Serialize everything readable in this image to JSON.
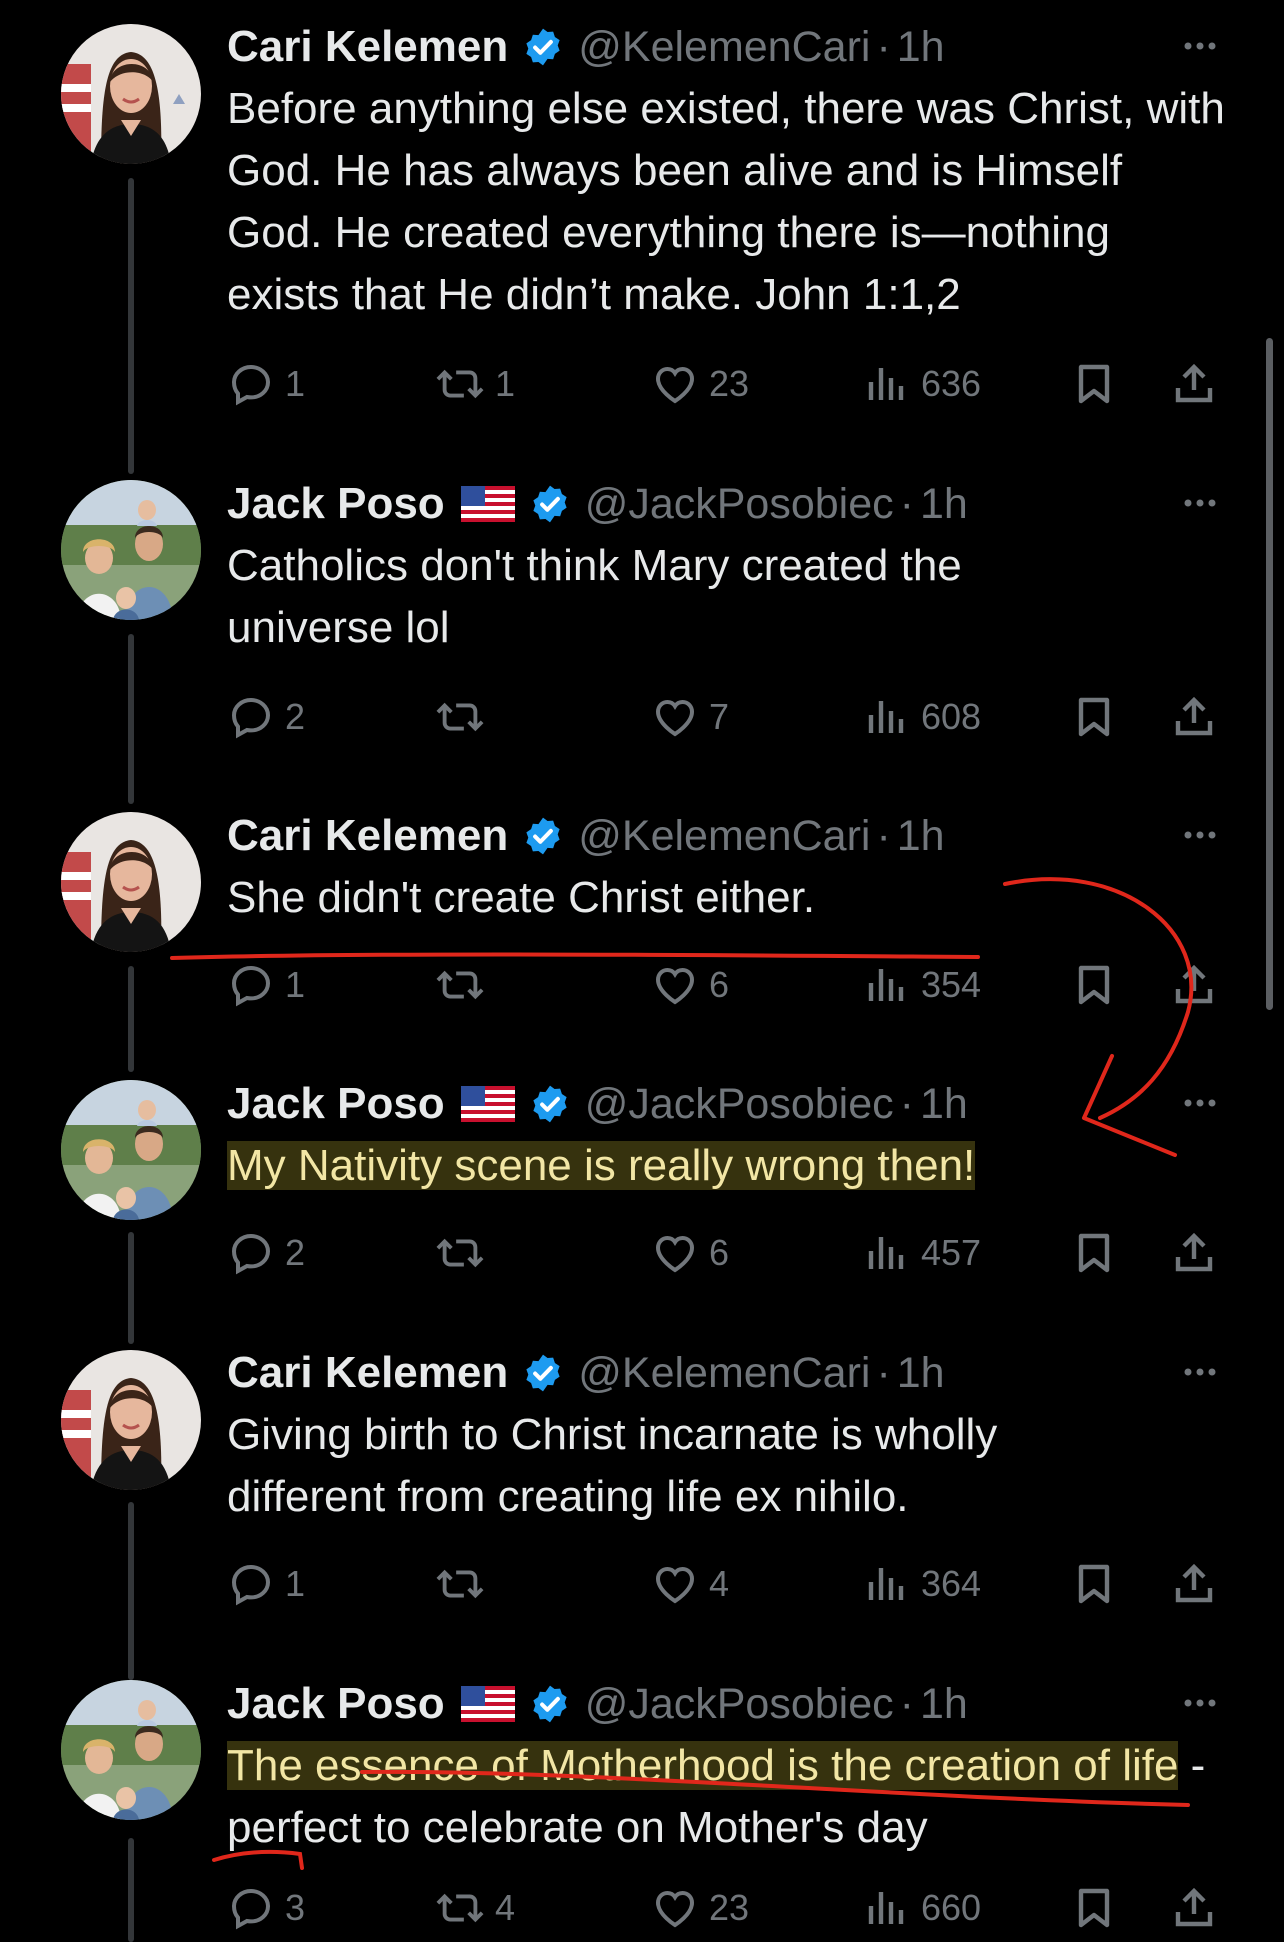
{
  "tweets": [
    {
      "author": "Cari Kelemen",
      "handle": "@KelemenCari",
      "time": "1h",
      "flag": false,
      "text": "Before anything else existed, there was Christ, with God. He has always been alive and is Himself God. He created everything there is—nothing exists that He didn’t make. John 1:1,2",
      "replies": "1",
      "reposts": "1",
      "likes": "23",
      "views": "636"
    },
    {
      "author": "Jack Poso",
      "handle": "@JackPosobiec",
      "time": "1h",
      "flag": true,
      "text": "Catholics don't think Mary created the universe lol",
      "replies": "2",
      "reposts": "",
      "likes": "7",
      "views": "608"
    },
    {
      "author": "Cari Kelemen",
      "handle": "@KelemenCari",
      "time": "1h",
      "flag": false,
      "text": "She didn't create Christ either.",
      "replies": "1",
      "reposts": "",
      "likes": "6",
      "views": "354"
    },
    {
      "author": "Jack Poso",
      "handle": "@JackPosobiec",
      "time": "1h",
      "flag": true,
      "text": "My Nativity scene is really wrong then!",
      "replies": "2",
      "reposts": "",
      "likes": "6",
      "views": "457"
    },
    {
      "author": "Cari Kelemen",
      "handle": "@KelemenCari",
      "time": "1h",
      "flag": false,
      "text": "Giving birth to Christ incarnate is wholly different from creating life ex nihilo.",
      "replies": "1",
      "reposts": "",
      "likes": "4",
      "views": "364"
    },
    {
      "author": "Jack Poso",
      "handle": "@JackPosobiec",
      "time": "1h",
      "flag": true,
      "text_highlight": "The essence of Motherhood is the creation of life",
      "text_rest": " - perfect to celebrate on Mother's day",
      "replies": "3",
      "reposts": "4",
      "likes": "23",
      "views": "660"
    }
  ],
  "colors": {
    "background": "#000000",
    "text": "#e7e9ea",
    "muted": "#71767b",
    "verified": "#1d9bf0",
    "highlight": "#f2e6a5",
    "annotation": "#e0271b"
  },
  "icons": [
    "reply-icon",
    "repost-icon",
    "like-icon",
    "views-icon",
    "bookmark-icon",
    "share-icon",
    "more-icon",
    "verified-badge-icon",
    "us-flag-icon"
  ]
}
